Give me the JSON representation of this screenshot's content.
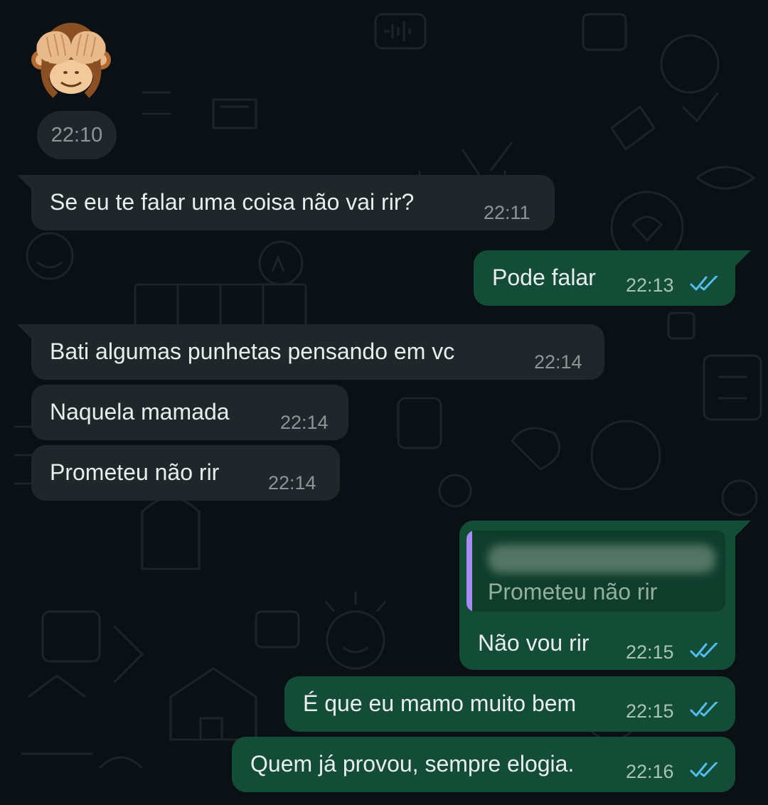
{
  "emoji_message": {
    "emoji_icon": "see-no-evil-monkey-icon",
    "time": "22:10"
  },
  "messages": [
    {
      "direction": "incoming",
      "text": "Se eu te falar uma coisa não vai rir?",
      "time": "22:11"
    },
    {
      "direction": "outgoing",
      "text": "Pode falar",
      "time": "22:13",
      "status_icon": "double-check-read-icon"
    },
    {
      "direction": "incoming",
      "text": "Bati algumas punhetas pensando em vc",
      "time": "22:14"
    },
    {
      "direction": "incoming",
      "text": "Naquela mamada",
      "time": "22:14"
    },
    {
      "direction": "incoming",
      "text": "Prometeu não rir",
      "time": "22:14"
    },
    {
      "direction": "outgoing",
      "quoted_text": "Prometeu não rir",
      "text": "Não vou rir",
      "time": "22:15",
      "status_icon": "double-check-read-icon"
    },
    {
      "direction": "outgoing",
      "text": "É que eu mamo muito bem",
      "time": "22:15",
      "status_icon": "double-check-read-icon"
    },
    {
      "direction": "outgoing",
      "text": "Quem já provou, sempre elogia.",
      "time": "22:16",
      "status_icon": "double-check-read-icon"
    }
  ],
  "colors": {
    "background": "#0b1014",
    "incoming_bubble": "#1f272a",
    "outgoing_bubble": "#134d37",
    "read_ticks": "#53bdeb",
    "quote_bar": "#a68bf2"
  }
}
